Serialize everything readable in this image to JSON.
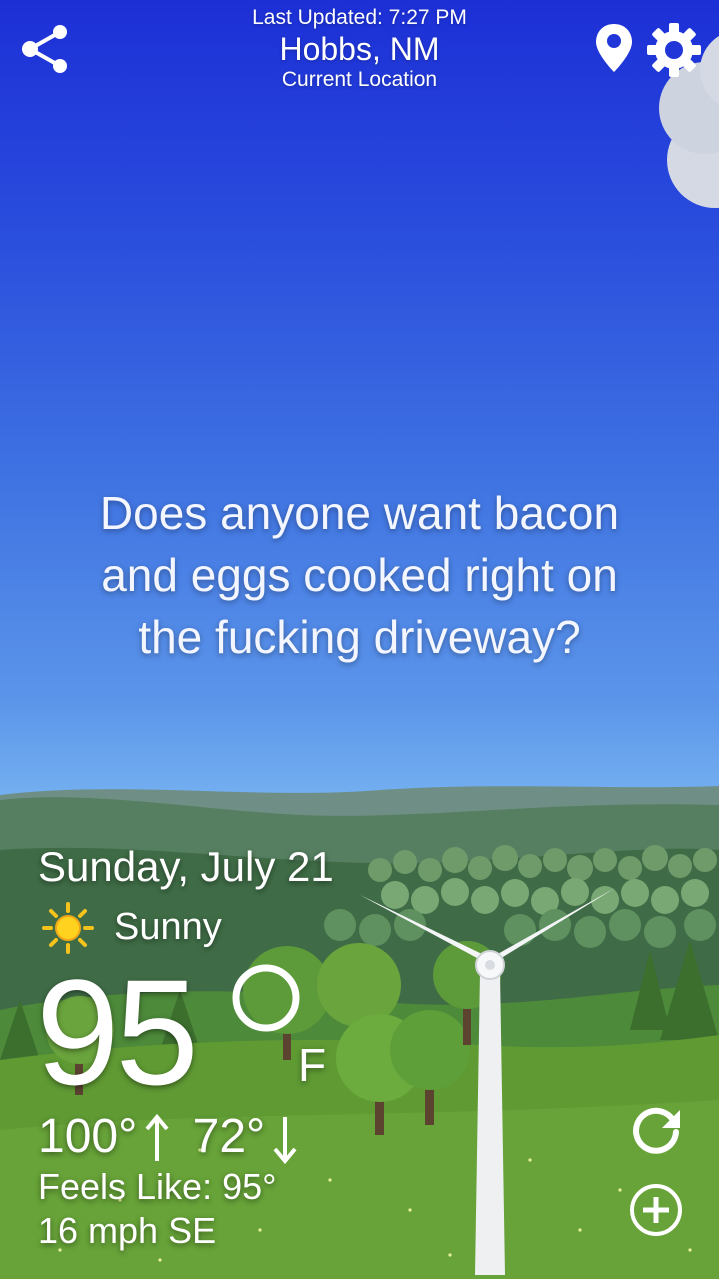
{
  "header": {
    "last_updated": "Last Updated: 7:27 PM",
    "city": "Hobbs, NM",
    "location_label": "Current Location"
  },
  "message": {
    "line1": "Does anyone want bacon",
    "line2": "and eggs cooked right on",
    "line3": "the fucking driveway?"
  },
  "weather": {
    "date": "Sunday, July 21",
    "condition": "Sunny",
    "condition_icon": "sun-icon",
    "temperature": "95",
    "unit": "F",
    "high": "100°",
    "low": "72°",
    "feels_like": "Feels Like: 95°",
    "wind": "16 mph SE"
  },
  "icons": {
    "share": "share-icon",
    "location": "location-pin-icon",
    "settings": "gear-icon",
    "refresh": "refresh-icon",
    "add": "add-circle-icon"
  },
  "colors": {
    "sky_top": "#1c2fd6",
    "sky_bottom": "#74b0f0",
    "hills_far": "#4f7d5a",
    "grass": "#5f9a33",
    "text": "#ffffff"
  }
}
